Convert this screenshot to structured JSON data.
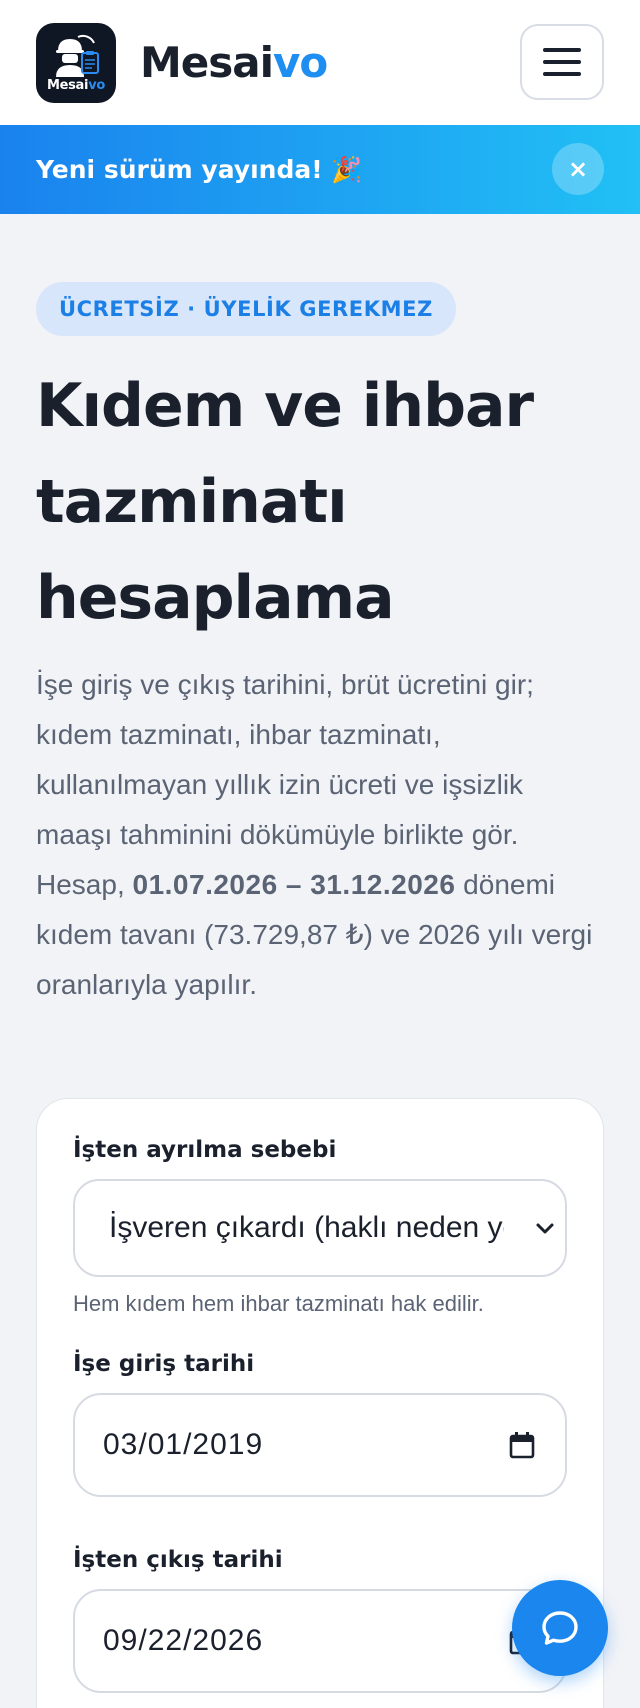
{
  "header": {
    "logo_text_main": "Mesai",
    "logo_text_accent": "vo",
    "brand_main": "Mesai",
    "brand_accent": "vo",
    "menu_icon": "hamburger-menu-icon"
  },
  "banner": {
    "text": "Yeni sürüm yayında! 🎉",
    "close_label": "×"
  },
  "hero": {
    "badge": "ÜCRETSİZ · ÜYELİK GEREKMEZ",
    "title": "Kıdem ve ihbar tazminatı hesaplama",
    "intro_part1": "İşe giriş ve çıkış tarihini, brüt ücretini gir; kıdem tazminatı, ihbar tazminatı, kullanılmayan yıllık izin ücreti ve işsizlik maaşı tahminini dökümüyle birlikte gör. Hesap, ",
    "intro_bold": "01.07.2026 – 31.12.2026",
    "intro_part2": " dönemi kıdem tavanı (73.729,87 ₺) ve 2026 yılı vergi oranlarıyla yapılır."
  },
  "form": {
    "reason_label": "İşten ayrılma sebebi",
    "reason_value": "İşveren çıkardı (haklı neden yok)",
    "reason_hint": "Hem kıdem hem ihbar tazminatı hak edilir.",
    "start_label": "İşe giriş tarihi",
    "start_value": "03/01/2019",
    "end_label": "İşten çıkış tarihi",
    "end_value": "09/22/2026"
  },
  "fab": {
    "icon": "chat-bubble-icon"
  },
  "colors": {
    "accent": "#1e8ef0",
    "banner_start": "#1a82ee",
    "banner_end": "#21c0f5",
    "badge_bg": "#d7e6fa"
  }
}
